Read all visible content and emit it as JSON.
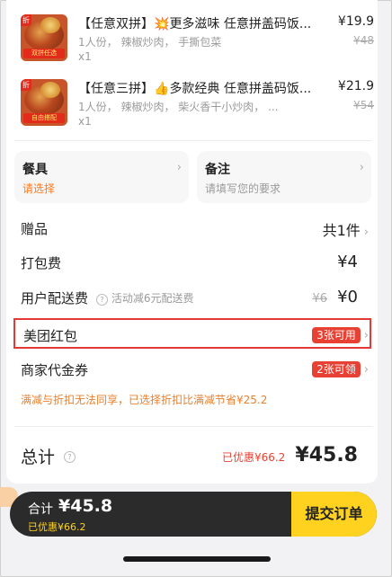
{
  "items": [
    {
      "tag": "折",
      "ribbon": "双拼任选",
      "title_pre": "【任意双拼】",
      "emoji": "💥",
      "title_post": "更多滋味 任意拼盖码饭...",
      "price": "¥19.9",
      "desc": "1人份， 辣椒炒肉， 手撕包菜",
      "orig_price": "¥48",
      "qty": "x1"
    },
    {
      "tag": "折",
      "ribbon": "自由搭配",
      "title_pre": "【任意三拼】",
      "emoji": "👍",
      "title_post": "多款经典 任意拼盖码饭...",
      "price": "¥21.9",
      "desc": "1人份， 辣椒炒肉， 柴火香干小炒肉， ...",
      "orig_price": "¥54",
      "qty": "x1"
    }
  ],
  "tableware": {
    "label": "餐具",
    "value": "请选择"
  },
  "remark": {
    "label": "备注",
    "placeholder": "请填写您的要求"
  },
  "gift": {
    "label": "赠品",
    "value": "共1件"
  },
  "packing": {
    "label": "打包费",
    "value": "¥4"
  },
  "delivery": {
    "label": "用户配送费",
    "info": "活动减6元配送费",
    "orig": "¥6",
    "value": "¥0"
  },
  "red_packet": {
    "label": "美团红包",
    "badge": "3张可用"
  },
  "voucher": {
    "label": "商家代金券",
    "badge": "2张可领"
  },
  "notice": "满减与折扣无法同享，已选择折扣比满减节省¥25.2",
  "total": {
    "label": "总计",
    "discount": "已优惠¥66.2",
    "amount": "¥45.8"
  },
  "bottom_bar": {
    "total_label": "合计",
    "total_value": "¥45.8",
    "discount": "已优惠¥66.2",
    "submit": "提交订单"
  },
  "colors": {
    "accent_orange": "#ff7a1a",
    "brand_yellow": "#ffd21f",
    "discount_red": "#e84133",
    "highlight_border": "#e53935"
  }
}
